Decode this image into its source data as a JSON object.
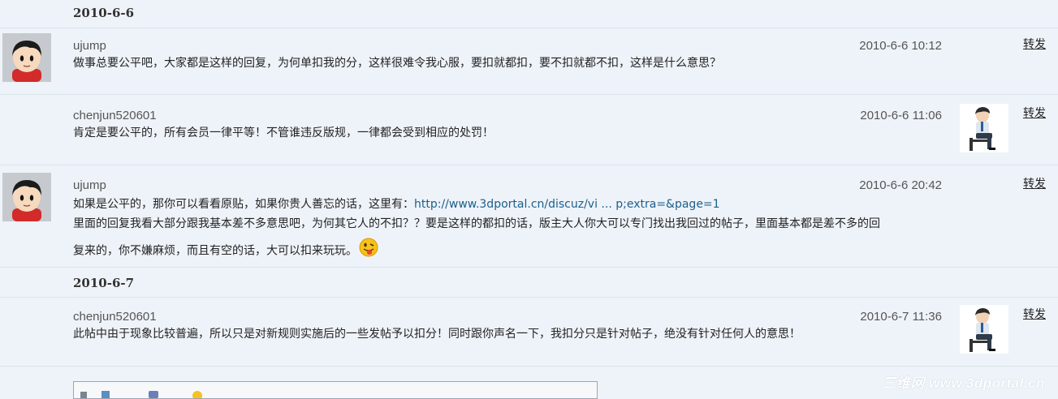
{
  "groups": [
    {
      "date": "2010-6-6",
      "messages": [
        {
          "user": "ujump",
          "time": "2010-6-6 10:12",
          "avatar_side": "left",
          "lines": [
            "做事总要公平吧，大家都是这样的回复，为何单扣我的分，这样很难令我心服，要扣就都扣，要不扣就都不扣，这样是什么意思？"
          ],
          "forward_label": "转发"
        },
        {
          "user": "chenjun520601",
          "time": "2010-6-6 11:06",
          "avatar_side": "right",
          "lines": [
            "肯定是要公平的，所有会员一律平等！不管谁违反版规，一律都会受到相应的处罚！"
          ],
          "forward_label": "转发"
        },
        {
          "user": "ujump",
          "time": "2010-6-6 20:42",
          "avatar_side": "left",
          "line1_prefix": "如果是公平的，那你可以看看原贴，如果你贵人善忘的话，这里有：",
          "link_text": "http://www.3dportal.cn/discuz/vi ... p;extra=&page=1",
          "line2": "里面的回复我看大部分跟我基本差不多意思吧，为何其它人的不扣？？要是这样的都扣的话，版主大人你大可以专门找出我回过的帖子，里面基本都是差不多的回",
          "line3": "复来的，你不嫌麻烦，而且有空的话，大可以扣来玩玩。",
          "emoji": "tongue-out-emoji",
          "forward_label": "转发"
        }
      ]
    },
    {
      "date": "2010-6-7",
      "messages": [
        {
          "user": "chenjun520601",
          "time": "2010-6-7 11:36",
          "avatar_side": "right",
          "lines": [
            "此帖中由于现象比较普遍，所以只是对新规则实施后的一些发帖予以扣分！同时跟你声名一下，我扣分只是针对帖子，绝没有针对任何人的意思！"
          ],
          "forward_label": "转发"
        }
      ]
    }
  ],
  "watermark": "三维网 www.3dportal.cn",
  "colors": {
    "background": "#eef3f9",
    "divider": "#dbe3ec",
    "link": "#1c5f8a"
  }
}
